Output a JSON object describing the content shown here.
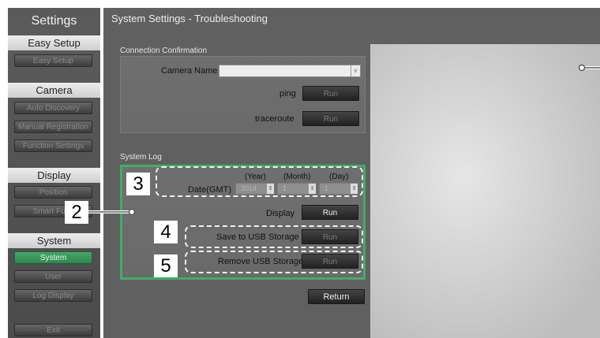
{
  "sidebar": {
    "title": "Settings",
    "sections": [
      {
        "header": "Easy Setup",
        "items": [
          {
            "label": "Easy Setup"
          }
        ]
      },
      {
        "header": "Camera",
        "items": [
          {
            "label": "Auto Discovery"
          },
          {
            "label": "Manual Registration"
          },
          {
            "label": "Function Settings"
          }
        ]
      },
      {
        "header": "Display",
        "items": [
          {
            "label": "Position"
          },
          {
            "label": "Smart Func"
          }
        ]
      },
      {
        "header": "System",
        "items": [
          {
            "label": "System",
            "active": true
          },
          {
            "label": "User"
          },
          {
            "label": "Log Display"
          }
        ]
      }
    ],
    "exit_label": "Exit"
  },
  "main": {
    "title": "System Settings - Troubleshooting",
    "connection": {
      "section_label": "Connection Confirmation",
      "camera_name_label": "Camera Name",
      "camera_name_value": "",
      "dropdown_arrow": "v",
      "ping_label": "ping",
      "ping_button": "Run",
      "traceroute_label": "traceroute",
      "traceroute_button": "Run"
    },
    "system_log": {
      "section_label": "System Log",
      "year_header": "(Year)",
      "month_header": "(Month)",
      "day_header": "(Day)",
      "date_label": "Date(GMT)",
      "year_value": "2014",
      "month_value": "1",
      "day_value": "1",
      "display_label": "Display",
      "display_button": "Run",
      "save_usb_label": "Save to USB Storage",
      "save_usb_button": "Run",
      "remove_usb_label": "Remove USB Storage",
      "remove_usb_button": "Run"
    },
    "return_button": "Return"
  },
  "callouts": {
    "c2": "2",
    "c3": "3",
    "c4": "4",
    "c5": "5"
  },
  "colors": {
    "active_green": "#2c8a4c",
    "panel_highlight": "#3fae63",
    "background": "#606060"
  }
}
